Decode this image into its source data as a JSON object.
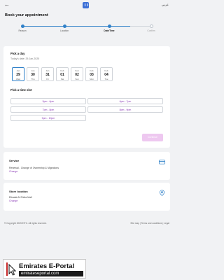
{
  "header": {
    "back_icon": "back-arrow-icon",
    "brand_icon": "portal-logo-icon",
    "language_label": "عربي"
  },
  "page": {
    "title": "Book your appointment"
  },
  "stepper": {
    "steps": [
      {
        "label": "Reason",
        "state": "done"
      },
      {
        "label": "Location",
        "state": "done"
      },
      {
        "label": "Date/Time",
        "state": "active"
      },
      {
        "label": "Confirm",
        "state": "todo"
      }
    ]
  },
  "day_picker": {
    "heading": "Pick a day",
    "today_text": "Today's date: 29-Jan-2025",
    "days": [
      {
        "month": "Jan",
        "date": "29",
        "weekday": "Wed",
        "selected": true
      },
      {
        "month": "Jan",
        "date": "30",
        "weekday": "Thu",
        "selected": false
      },
      {
        "month": "Jan",
        "date": "31",
        "weekday": "Fri",
        "selected": false
      },
      {
        "month": "Feb",
        "date": "01",
        "weekday": "Sat",
        "selected": false
      },
      {
        "month": "Feb",
        "date": "02",
        "weekday": "Sun",
        "selected": false
      },
      {
        "month": "Feb",
        "date": "03",
        "weekday": "Mon",
        "selected": false
      },
      {
        "month": "Feb",
        "date": "04",
        "weekday": "Tue",
        "selected": false
      }
    ]
  },
  "time_picker": {
    "heading": "Pick a time slot",
    "slots": [
      "5pm - 6pm",
      "6pm - 7pm",
      "7pm - 8pm",
      "8pm - 9pm",
      "9pm - 10pm"
    ]
  },
  "continue_label": "Continue",
  "service_card": {
    "title": "Service",
    "line": "Renewal - Change of Ownership & Migrations",
    "link": "Change",
    "icon": "card-icon"
  },
  "store_card": {
    "title": "Store location",
    "line": "Etisalat Al Shiba Mall",
    "link": "Change",
    "icon": "location-pin-icon"
  },
  "footer": {
    "copyright": "© Copyright 2025 EITC. All rights reserved.",
    "links": "Site map | Terms and conditions | Legal"
  },
  "watermark": {
    "title": "Emirates E-Portal",
    "url": "emirateseportal.com"
  },
  "colors": {
    "accent": "#2f80c8",
    "purple": "#8a3bb5",
    "continue_disabled": "#eec8f0"
  }
}
